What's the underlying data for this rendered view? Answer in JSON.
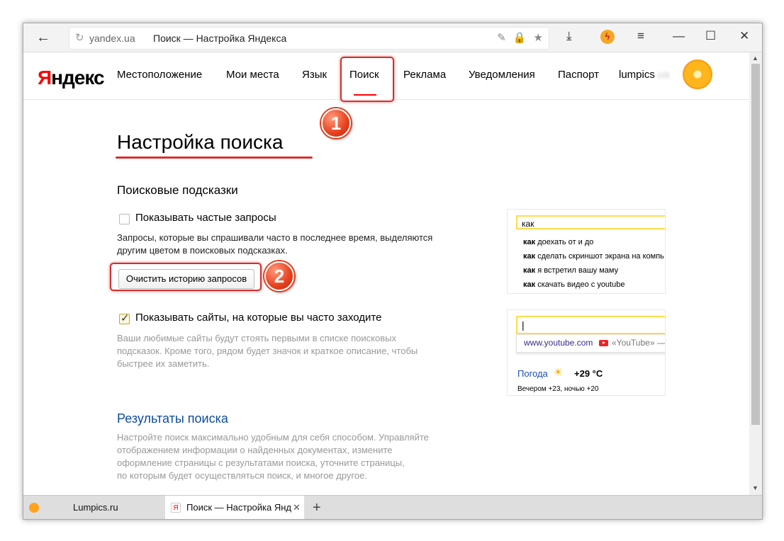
{
  "browser": {
    "domain": "yandex.ua",
    "page_title": "Поиск — Настройка Яндекса",
    "back_glyph": "←",
    "reload_glyph": "↻",
    "icons": [
      "key-icon",
      "lock-icon",
      "star-icon",
      "download-icon",
      "turbo-icon",
      "menu-icon",
      "minimize-icon",
      "maximize-icon",
      "close-icon"
    ],
    "window_controls": {
      "menu": "≡",
      "minimize": "—",
      "maximize": "☐",
      "close": "✕"
    }
  },
  "header": {
    "logo_first": "Я",
    "logo_rest": "ндекс",
    "nav": [
      "Местоположение",
      "Мои места",
      "Язык",
      "Поиск",
      "Реклама",
      "Уведомления",
      "Паспорт"
    ],
    "active_nav": "Поиск",
    "username": "lumpics",
    "username_blurred": ".ua"
  },
  "content": {
    "page_heading": "Настройка поиска",
    "section_suggestions": "Поисковые подсказки",
    "frequent_queries": {
      "label": "Показывать частые запросы",
      "checked": false,
      "description_line1": "Запросы, которые вы спрашивали часто в последнее время, выделяются",
      "description_line2": "другим цветом в поисковых подсказках."
    },
    "clear_history_button": "Очистить историю запросов",
    "frequent_sites": {
      "label": "Показывать сайты, на которые вы часто заходите",
      "checked": true,
      "description_line1": "Ваши любимые сайты будут стоять первыми в списке поисковых",
      "description_line2": "подсказок. Кроме того, рядом будет значок и краткое описание, чтобы",
      "description_line3": "быстрее их заметить."
    },
    "section_results": "Результаты поиска",
    "results_description": [
      "Настройте поиск максимально удобным для себя способом. Управляйте",
      "отображением информации о найденных документах, измените",
      "оформление страницы с результатами поиска, уточните страницы,",
      "по которым будет осуществляться поиск, и многое другое."
    ],
    "badges": [
      "1",
      "2"
    ]
  },
  "preview1": {
    "query": "как",
    "suggestions": [
      {
        "bold": "как",
        "rest": " доехать от и до"
      },
      {
        "bold": "как",
        "rest": " сделать скриншот экрана на компь"
      },
      {
        "bold": "как",
        "rest": " я встретил вашу маму"
      },
      {
        "bold": "как",
        "rest": " скачать видео с youtube"
      }
    ]
  },
  "preview2": {
    "cursor": "|",
    "site_link": "www.youtube.com",
    "site_desc": "«YouTube» —",
    "weather_label": "Погода",
    "weather_temp": "+29 °C",
    "weather_sub": "Вечером +23,  ночью +20"
  },
  "tabs": [
    {
      "title": "Lumpics.ru",
      "active": false
    },
    {
      "title": "Поиск — Настройка Янд",
      "active": true
    }
  ],
  "tab_close_glyph": "✕",
  "new_tab_glyph": "+",
  "colors": {
    "yandex_red": "#ff0000",
    "highlight_red": "#d12f2f",
    "link_blue": "#0c4d9e",
    "input_yellow": "#ffdb4d"
  }
}
